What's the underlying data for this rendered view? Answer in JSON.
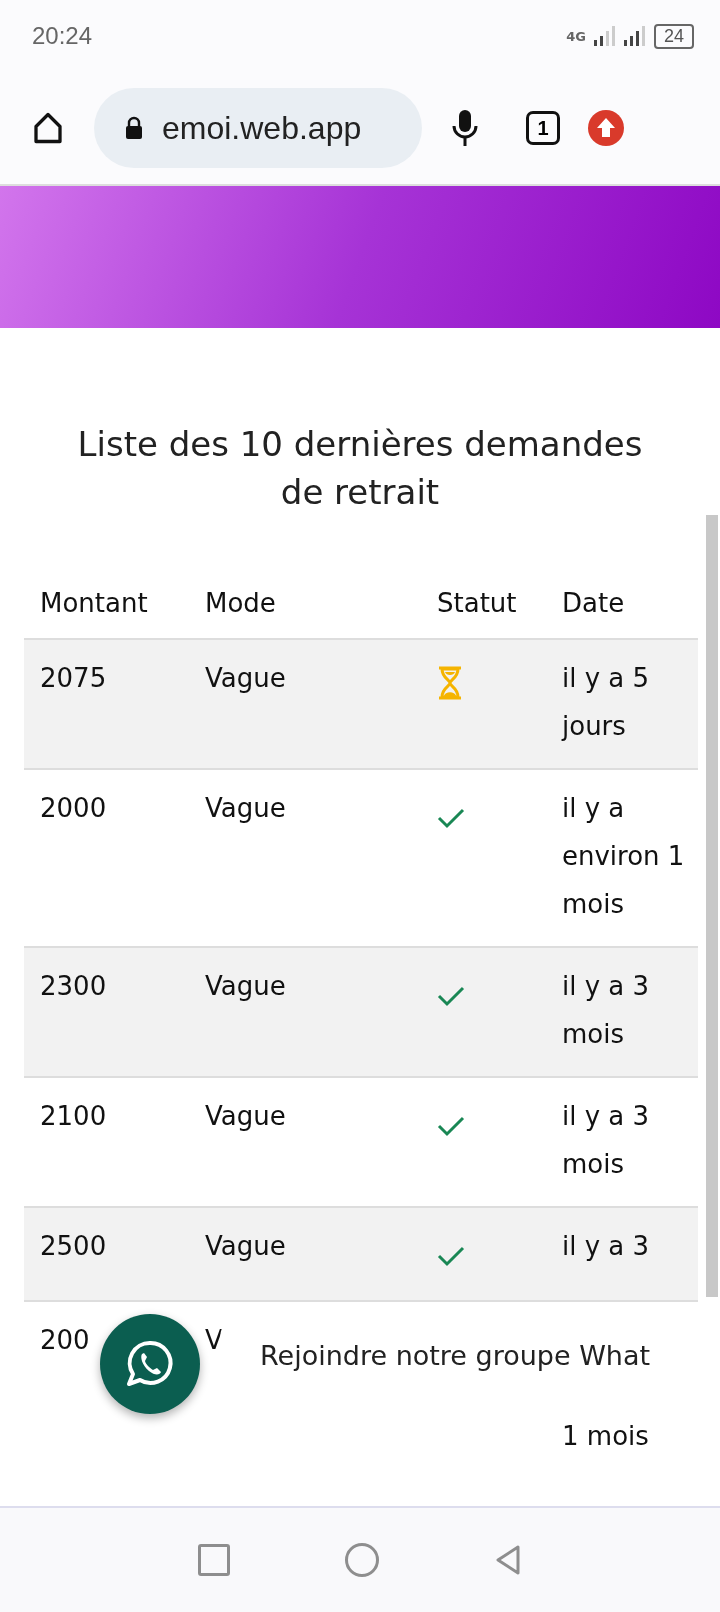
{
  "status_bar": {
    "time": "20:24",
    "network": "4G",
    "battery": "24"
  },
  "browser": {
    "url": "emoi.web.app",
    "tab_count": "1"
  },
  "page": {
    "title": "Liste des 10 dernières demandes de retrait"
  },
  "table": {
    "columns": [
      "Montant",
      "Mode",
      "Statut",
      "Date"
    ],
    "rows": [
      {
        "kind": "pending",
        "amount": "2075",
        "mode": "Vague",
        "date": "il y a 5 jours"
      },
      {
        "kind": "approved",
        "amount": "2000",
        "mode": "Vague",
        "date": "il y a environ 1 mois"
      },
      {
        "kind": "approved",
        "amount": "2300",
        "mode": "Vague",
        "date": "il y a 3 mois"
      },
      {
        "kind": "approved",
        "amount": "2100",
        "mode": "Vague",
        "date": "il y a 3 mois"
      },
      {
        "kind": "approved",
        "amount": "2500",
        "mode": "Vague",
        "date": "il y a 3"
      },
      {
        "kind": "covered",
        "amount": "200",
        "mode": "V",
        "date": "1 mois"
      }
    ]
  },
  "whatsapp_banner": {
    "text": "Rejoindre notre groupe What"
  }
}
